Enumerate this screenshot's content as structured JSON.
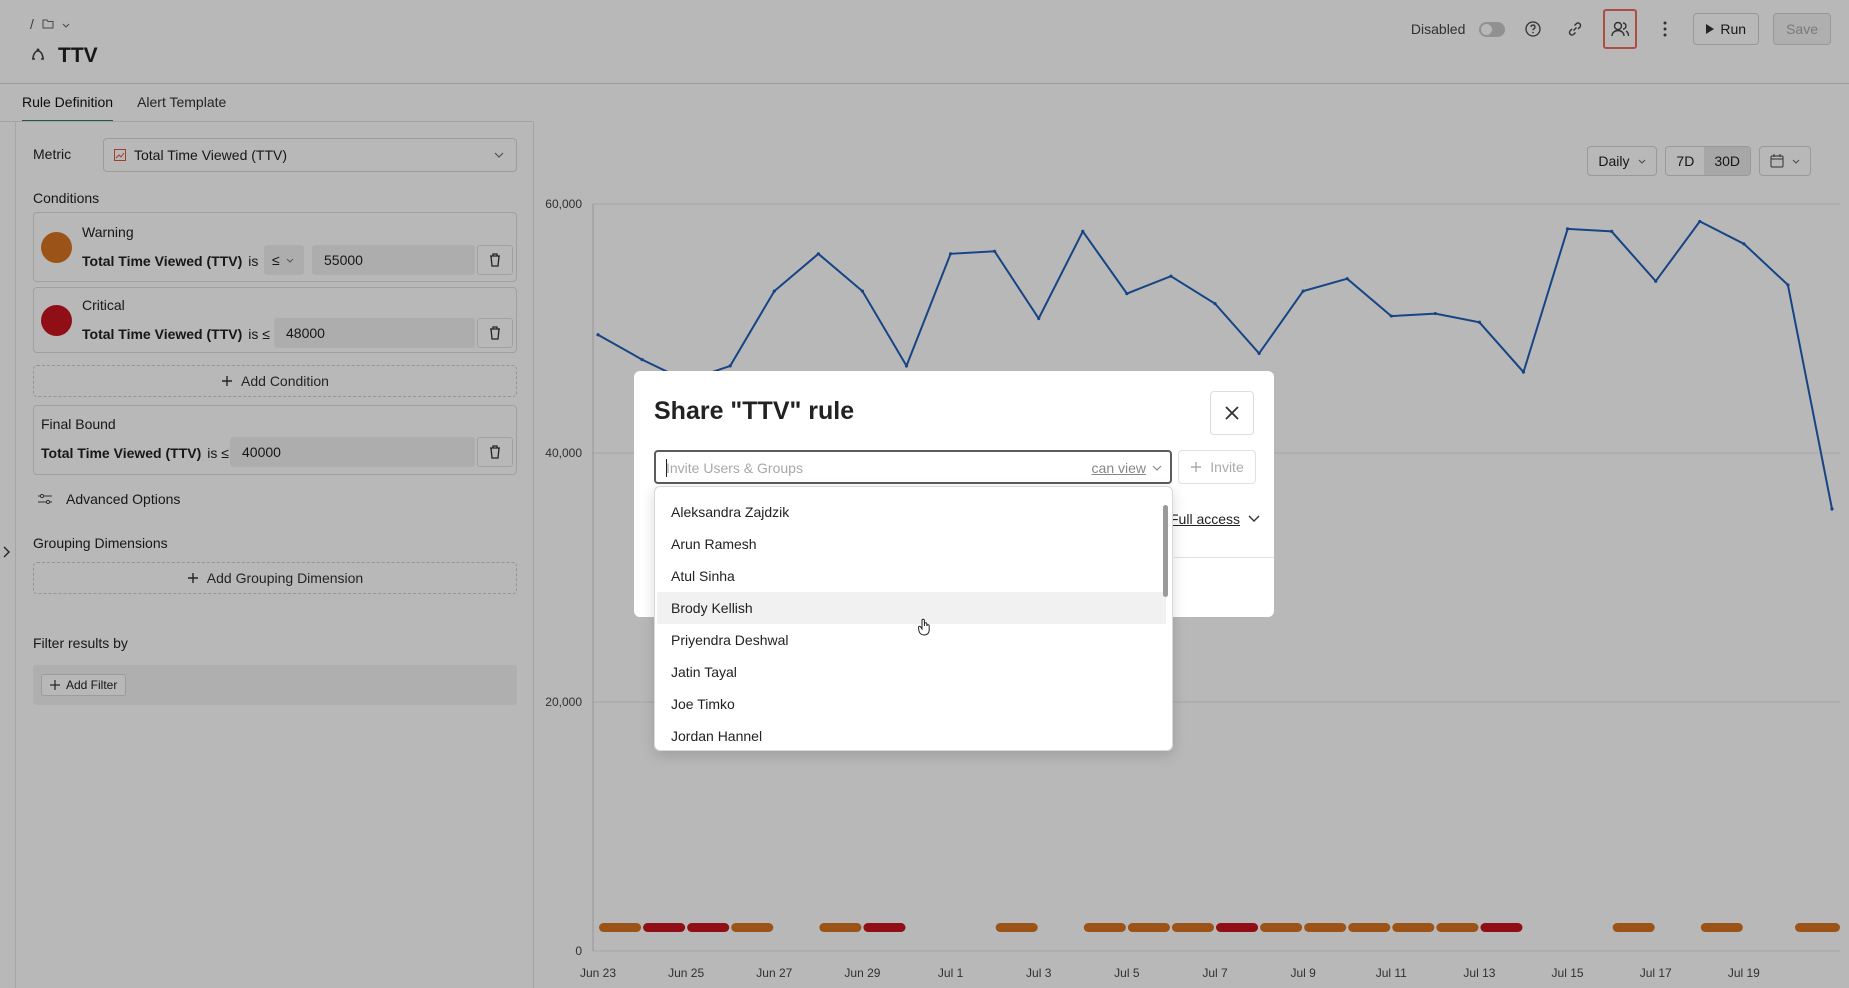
{
  "header": {
    "breadcrumb_sep": "/",
    "title": "TTV",
    "disabled_label": "Disabled",
    "run_label": "Run",
    "save_label": "Save"
  },
  "tabs": [
    {
      "label": "Rule Definition",
      "active": true
    },
    {
      "label": "Alert Template",
      "active": false
    }
  ],
  "left": {
    "metric_label": "Metric",
    "metric_value": "Total Time Viewed (TTV)",
    "conditions_label": "Conditions",
    "warning": {
      "title": "Warning",
      "metric": "Total Time Viewed (TTV)",
      "is": "is",
      "op": "≤",
      "value": "55000",
      "color": "#d97321"
    },
    "critical": {
      "title": "Critical",
      "metric": "Total Time Viewed (TTV)",
      "is": "is ≤",
      "value": "48000",
      "color": "#c8141e"
    },
    "add_condition": "Add Condition",
    "final_bound": {
      "title": "Final Bound",
      "metric": "Total Time Viewed (TTV)",
      "is": "is ≤",
      "value": "40000"
    },
    "advanced_options": "Advanced Options",
    "grouping_label": "Grouping Dimensions",
    "add_grouping": "Add Grouping Dimension",
    "filter_label": "Filter results by",
    "add_filter": "Add Filter"
  },
  "chart_controls": {
    "granularity": "Daily",
    "range_7d": "7D",
    "range_30d": "30D"
  },
  "chart_data": {
    "type": "line",
    "ylim": [
      0,
      60000
    ],
    "y_ticks": [
      "60,000",
      "40,000",
      "20,000",
      "0"
    ],
    "x_tick_labels": [
      "Jun 23",
      "Jun 25",
      "Jun 27",
      "Jun 29",
      "Jul 1",
      "Jul 3",
      "Jul 5",
      "Jul 7",
      "Jul 9",
      "Jul 11",
      "Jul 13",
      "Jul 15",
      "Jul 17",
      "Jul 19"
    ],
    "series": [
      {
        "color": "#1f5fb8",
        "values": [
          49500,
          47500,
          45800,
          47000,
          53000,
          56000,
          53000,
          47000,
          56000,
          56200,
          50800,
          57800,
          52800,
          54200,
          52000,
          48000,
          53000,
          54000,
          51000,
          51200,
          50500,
          46500,
          58000,
          57800,
          53800,
          58600,
          56800,
          53500,
          35500
        ]
      }
    ],
    "alert_bar": [
      "warning",
      "critical",
      "critical",
      "warning",
      null,
      "warning",
      "critical",
      null,
      null,
      "warning",
      null,
      "warning",
      "warning",
      "warning",
      "critical",
      "warning",
      "warning",
      "warning",
      "warning",
      "warning",
      "critical",
      null,
      null,
      "warning",
      null,
      "warning"
    ],
    "alert_colors": {
      "warning": "#d97321",
      "critical": "#c8141e"
    }
  },
  "modal": {
    "title": "Share \"TTV\" rule",
    "invite_placeholder": "Invite Users & Groups",
    "permission": "can view",
    "invite_label": "Invite",
    "full_access": "Full access"
  },
  "dropdown": {
    "items": [
      "Aleksandra Zajdzik",
      "Arun Ramesh",
      "Atul Sinha",
      "Brody Kellish",
      "Priyendra Deshwal",
      "Jatin Tayal",
      "Joe Timko",
      "Jordan Hannel"
    ],
    "hovered_index": 3
  }
}
